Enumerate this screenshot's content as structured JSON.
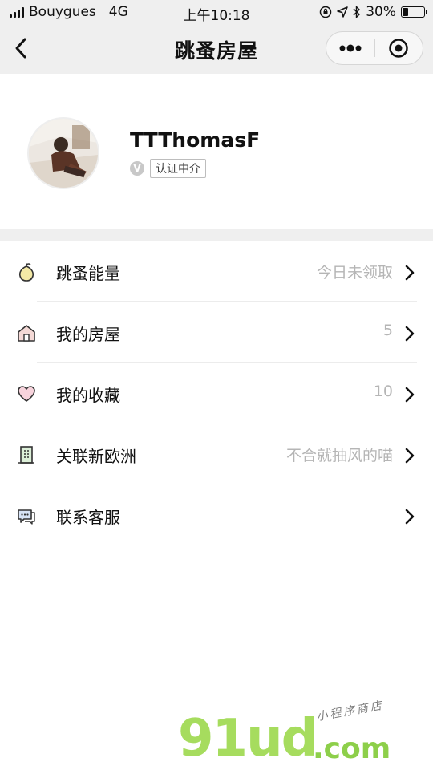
{
  "status_bar": {
    "carrier": "Bouygues",
    "network": "4G",
    "time": "上午10:18",
    "battery_percent": "30%",
    "battery_level": 0.3
  },
  "nav": {
    "title": "跳蚤房屋",
    "back_icon": "chevron-left-icon",
    "more_icon": "more-dots-icon",
    "close_icon": "target-icon"
  },
  "profile": {
    "username": "TTThomasF",
    "verify_badge": "V",
    "verify_tag": "认证中介"
  },
  "menu": [
    {
      "icon": "gourd-icon",
      "label": "跳蚤能量",
      "value": "今日未领取"
    },
    {
      "icon": "house-icon",
      "label": "我的房屋",
      "value": "5"
    },
    {
      "icon": "heart-icon",
      "label": "我的收藏",
      "value": "10"
    },
    {
      "icon": "building-icon",
      "label": "关联新欧洲",
      "value": "不合就抽风的喵"
    },
    {
      "icon": "chat-icon",
      "label": "联系客服",
      "value": ""
    }
  ],
  "watermark": {
    "brand": "91ud",
    "domain": ".com",
    "subtitle": "小程序商店"
  },
  "colors": {
    "bar_bg": "#efefef",
    "value_gray": "#b5b5b5",
    "watermark_green": "#a6dc5e"
  }
}
